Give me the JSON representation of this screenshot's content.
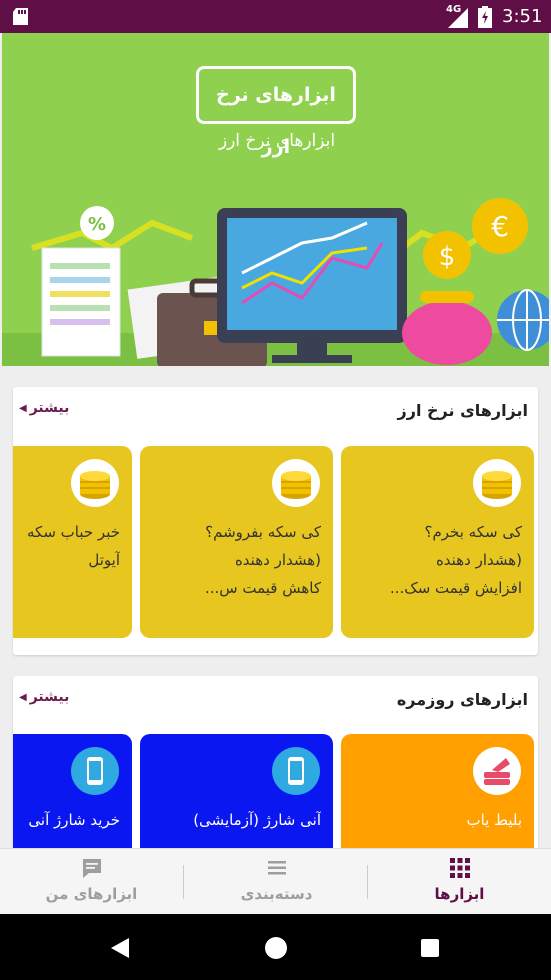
{
  "status_bar": {
    "network": "4G",
    "time": "3:51"
  },
  "banner": {
    "title": "ابزارهای نرخ ارز",
    "subtitle": "ابزارهای نرخ ارز"
  },
  "sections": [
    {
      "title": "ابزارهای نرخ ارز",
      "more_label": "بیشتر",
      "tiles": [
        {
          "line1": "کی سکه بخرم؟",
          "line2": "(هشدار دهنده",
          "line3": "افزایش قیمت سک...",
          "icon": "coin-stack-icon"
        },
        {
          "line1": "کی سکه بفروشم؟",
          "line2": "(هشدار دهنده",
          "line3": "کاهش قیمت س...",
          "icon": "coin-stack-icon"
        },
        {
          "line1": "خبر حباب سکه",
          "line2": "آیوتل",
          "line3": "",
          "icon": "coin-stack-icon"
        }
      ]
    },
    {
      "title": "ابزارهای روزمره",
      "more_label": "بیشتر",
      "tiles": [
        {
          "line1": "بلیط یاب",
          "icon": "ticket-icon",
          "color": "#ff9f00"
        },
        {
          "line1": "آنی شارژ (آزمایشی)",
          "icon": "phone-icon",
          "color": "#0a17f0"
        },
        {
          "line1": "خرید شارژ آنی",
          "icon": "phone-icon",
          "color": "#0a17f0"
        }
      ]
    }
  ],
  "bottom_nav": {
    "tools": "ابزارها",
    "categories": "دسته‌بندی",
    "my_tools": "ابزارهای من"
  },
  "colors": {
    "primary": "#5f0f45",
    "banner_bg": "#8fd14f",
    "tile_yellow": "#e7c61f",
    "tile_orange": "#ff9f00",
    "tile_blue": "#0a17f0"
  }
}
